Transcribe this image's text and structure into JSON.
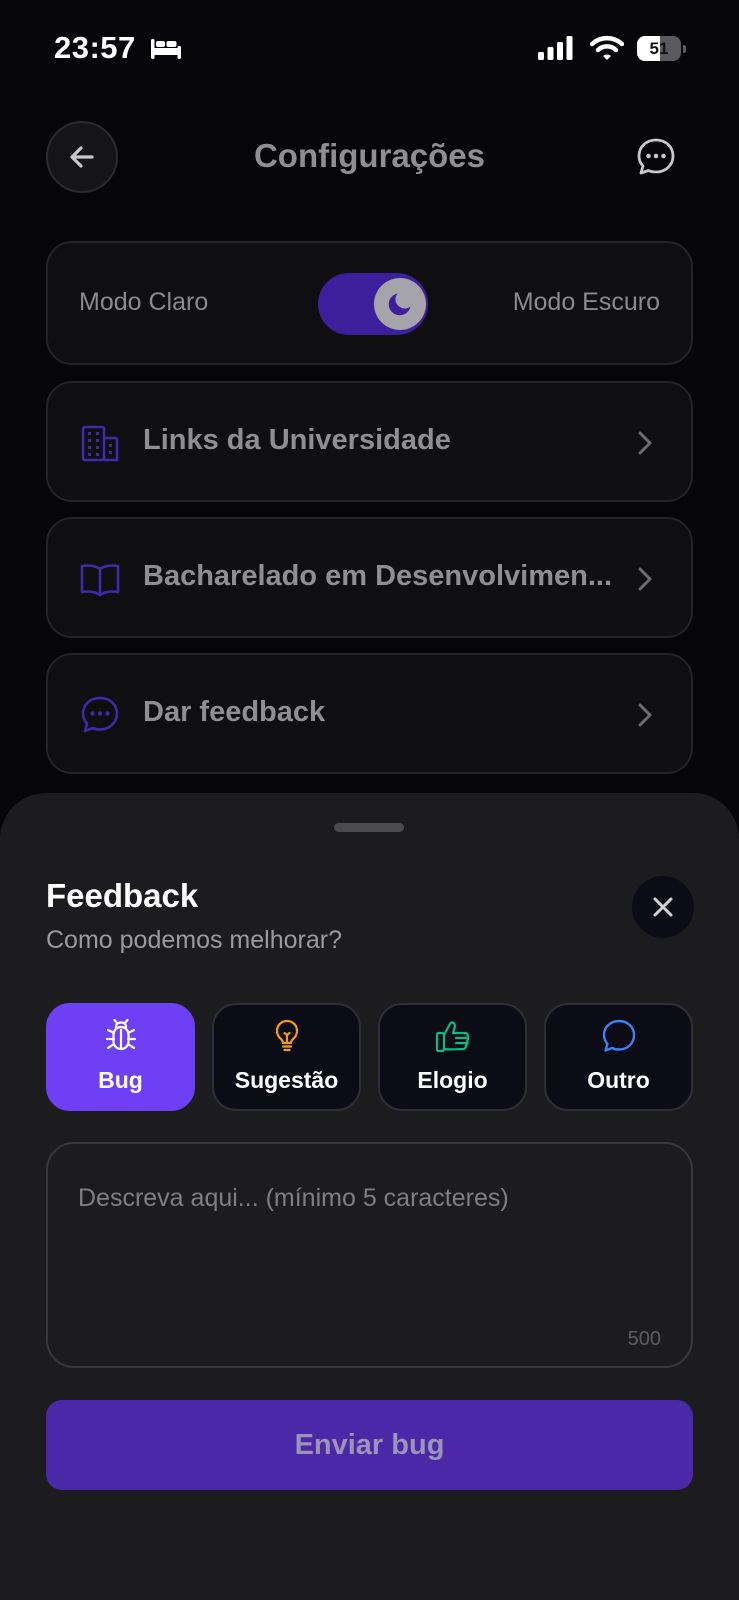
{
  "status_bar": {
    "time": "23:57",
    "battery_level": "51",
    "icons": [
      "bed-icon",
      "cellular-signal-icon",
      "wifi-icon",
      "battery-icon"
    ]
  },
  "header": {
    "title": "Configurações",
    "back_icon": "arrow-left-icon",
    "action_icon": "chat-bubble-dots-icon"
  },
  "theme": {
    "light_label": "Modo Claro",
    "dark_label": "Modo Escuro",
    "dark_mode_enabled": true,
    "knob_icon": "moon-icon"
  },
  "menu": {
    "items": [
      {
        "label": "Links da Universidade",
        "icon": "building-icon"
      },
      {
        "label": "Bacharelado em Desenvolvimen...",
        "icon": "book-open-icon"
      },
      {
        "label": "Dar feedback",
        "icon": "chat-bubble-dots-icon"
      }
    ]
  },
  "sheet": {
    "title": "Feedback",
    "subtitle": "Como podemos melhorar?",
    "close_icon": "close-icon",
    "types": [
      {
        "label": "Bug",
        "icon": "bug-icon",
        "selected": true
      },
      {
        "label": "Sugestão",
        "icon": "lightbulb-icon",
        "selected": false
      },
      {
        "label": "Elogio",
        "icon": "thumbs-up-icon",
        "selected": false
      },
      {
        "label": "Outro",
        "icon": "chat-bubble-icon",
        "selected": false
      }
    ],
    "textarea_placeholder": "Descreva aqui... (mínimo 5 caracteres)",
    "textarea_value": "",
    "char_limit": "500",
    "submit_label": "Enviar bug"
  },
  "colors": {
    "accent": "#6e3ff5",
    "accent_dark": "#4a28a8",
    "lightbulb": "#f59e0b",
    "thumbs_up": "#10b981",
    "chat_blue": "#3b82f6",
    "background": "#060609",
    "sheet": "#1c1c1e"
  }
}
